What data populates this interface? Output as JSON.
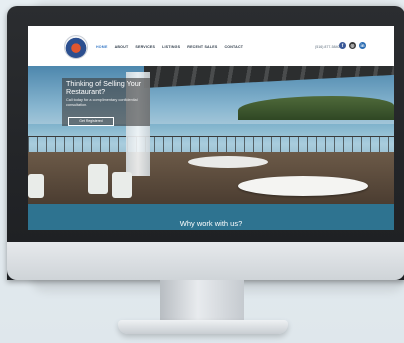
{
  "site": {
    "nav": [
      "HOME",
      "ABOUT",
      "SERVICES",
      "LISTINGS",
      "RECENT SALES",
      "CONTACT"
    ],
    "active_index": 0,
    "phone": "(516) 877-5840",
    "social": [
      {
        "icon": "facebook-icon",
        "glyph": "f",
        "color": "#3b5998"
      },
      {
        "icon": "instagram-icon",
        "glyph": "◎",
        "color": "#3a3a3a"
      },
      {
        "icon": "linkedin-icon",
        "glyph": "in",
        "color": "#2c6db3"
      }
    ],
    "hero": {
      "title": "Thinking of Selling Your Restaurant?",
      "subtitle": "Call today for a complimentary confidential consultation.",
      "cta": "Get Registered"
    },
    "band_heading": "Why work with us?"
  },
  "colors": {
    "accent": "#3a7bc7",
    "band": "#2e7390",
    "nav_text": "#2d3a48"
  }
}
